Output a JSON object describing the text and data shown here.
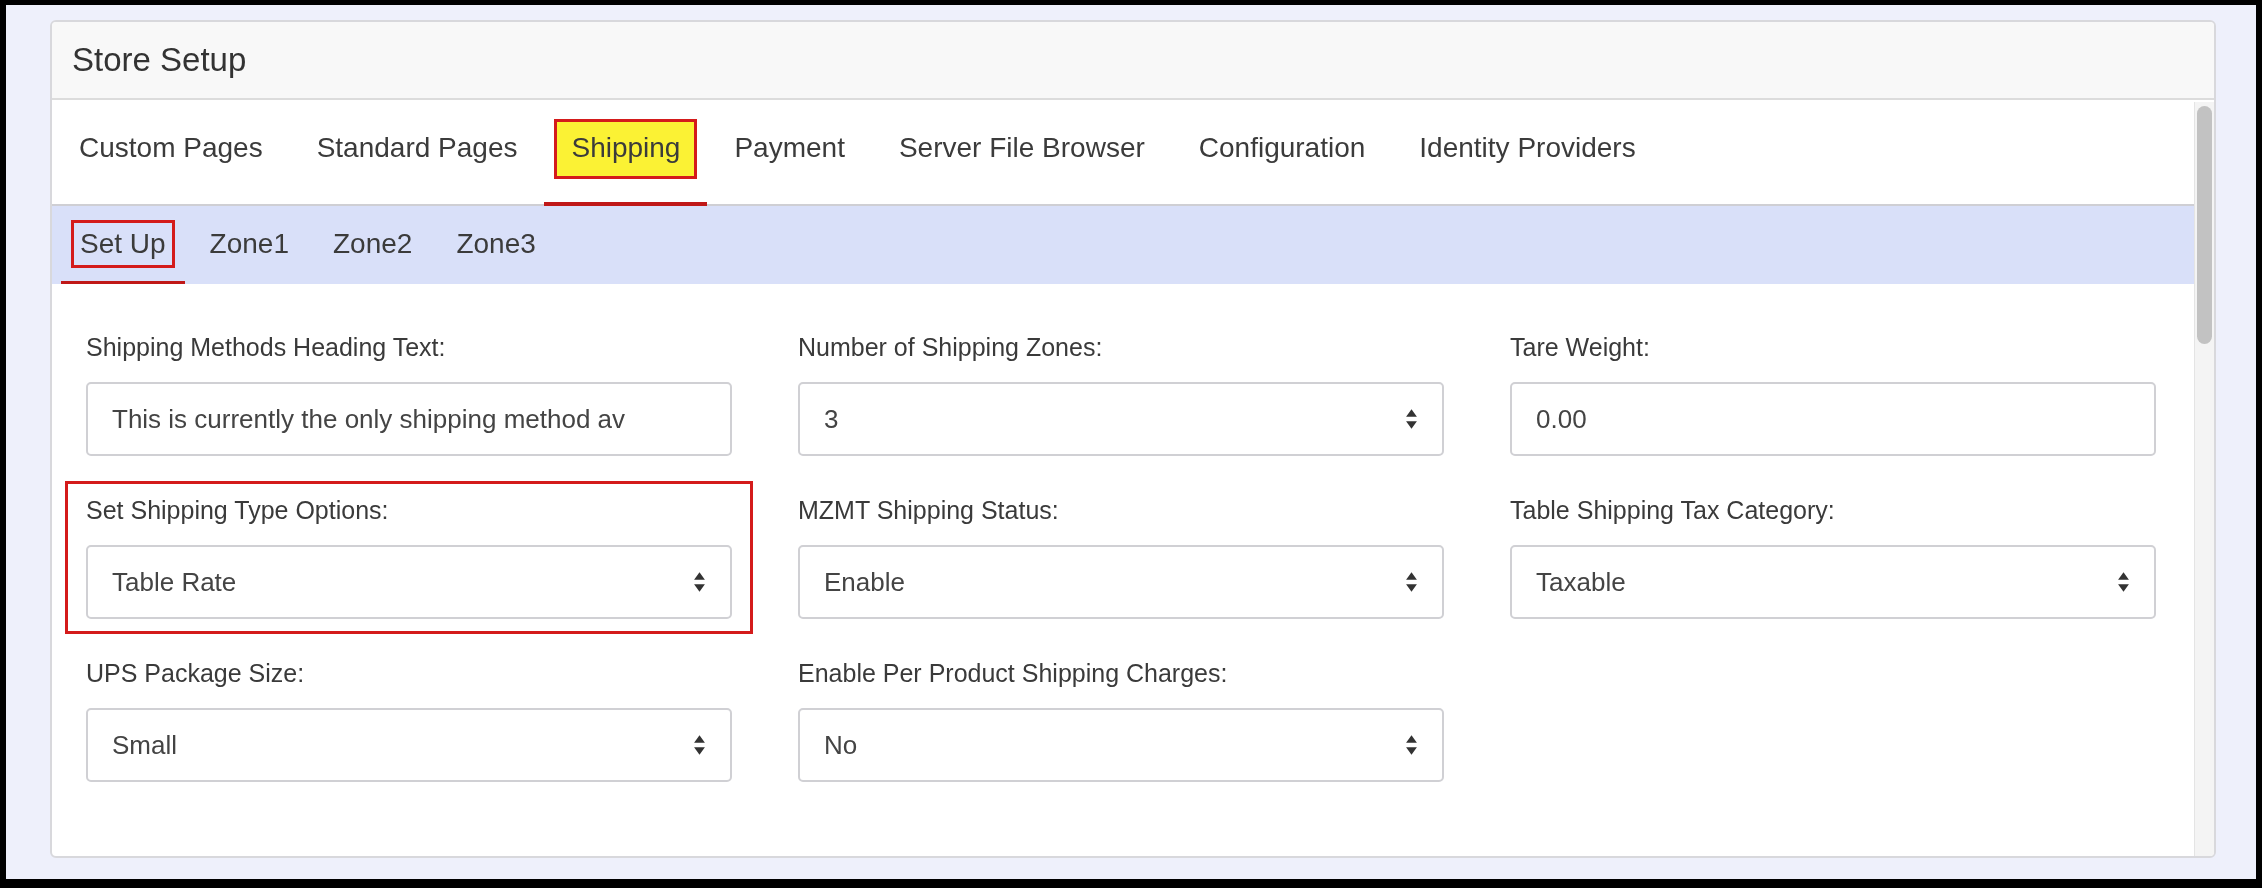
{
  "panel": {
    "title": "Store Setup"
  },
  "tabs": [
    {
      "label": "Custom Pages",
      "selected": false,
      "highlighted": false
    },
    {
      "label": "Standard Pages",
      "selected": false,
      "highlighted": false
    },
    {
      "label": "Shipping",
      "selected": true,
      "highlighted": true
    },
    {
      "label": "Payment",
      "selected": false,
      "highlighted": false
    },
    {
      "label": "Server File Browser",
      "selected": false,
      "highlighted": false
    },
    {
      "label": "Configuration",
      "selected": false,
      "highlighted": false
    },
    {
      "label": "Identity Providers",
      "selected": false,
      "highlighted": false
    }
  ],
  "subtabs": [
    {
      "label": "Set Up",
      "selected": true,
      "highlighted": true
    },
    {
      "label": "Zone1",
      "selected": false,
      "highlighted": false
    },
    {
      "label": "Zone2",
      "selected": false,
      "highlighted": false
    },
    {
      "label": "Zone3",
      "selected": false,
      "highlighted": false
    }
  ],
  "fields": [
    {
      "label": "Shipping Methods Heading Text:",
      "kind": "text",
      "value": "This is currently the only shipping method av",
      "highlighted": false
    },
    {
      "label": "Number of Shipping Zones:",
      "kind": "select",
      "value": "3",
      "highlighted": false
    },
    {
      "label": "Tare Weight:",
      "kind": "text",
      "value": "0.00",
      "highlighted": false
    },
    {
      "label": "Set Shipping Type Options:",
      "kind": "select",
      "value": "Table Rate",
      "highlighted": true
    },
    {
      "label": "MZMT Shipping Status:",
      "kind": "select",
      "value": "Enable",
      "highlighted": false
    },
    {
      "label": "Table Shipping Tax Category:",
      "kind": "select",
      "value": "Taxable",
      "highlighted": false
    },
    {
      "label": "UPS Package Size:",
      "kind": "select",
      "value": "Small",
      "highlighted": false
    },
    {
      "label": "Enable Per Product Shipping Charges:",
      "kind": "select",
      "value": "No",
      "highlighted": false
    }
  ]
}
